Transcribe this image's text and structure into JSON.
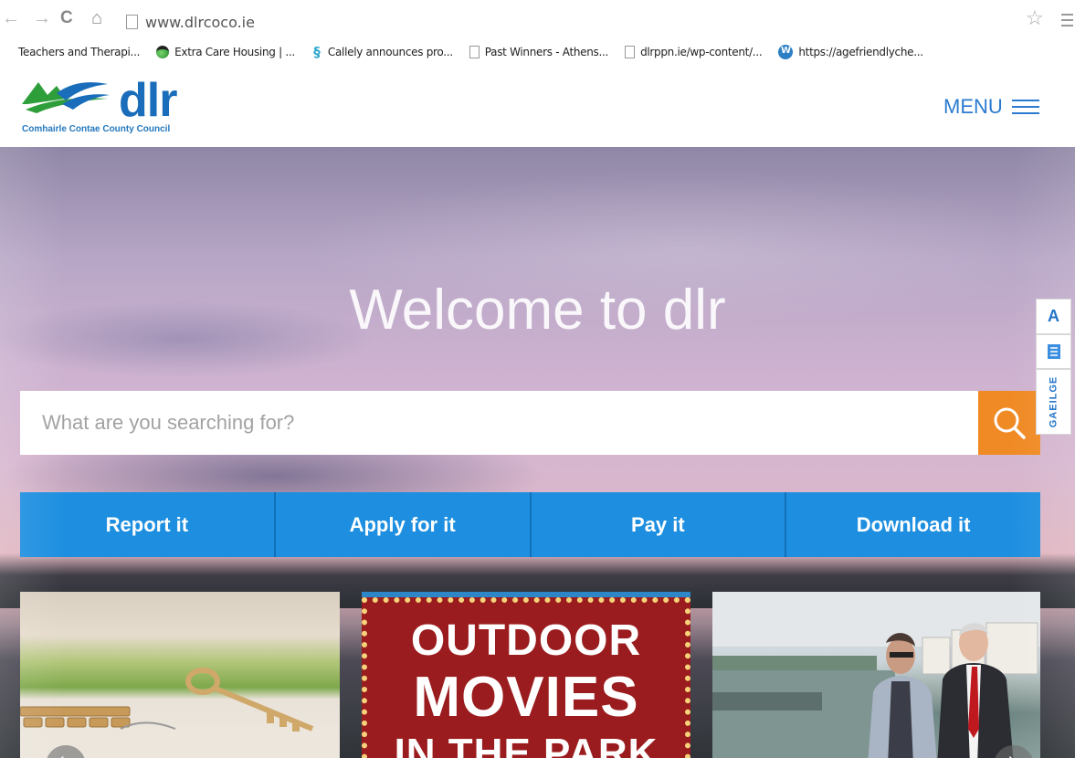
{
  "browser": {
    "url": "www.dlrcoco.ie",
    "bookmarks": [
      {
        "label": "Teachers and Therapi...",
        "icon": "none"
      },
      {
        "label": "Extra Care Housing | ...",
        "icon": "globe-icon"
      },
      {
        "label": "Callely announces pro...",
        "icon": "swirl-icon"
      },
      {
        "label": "Past Winners - Athens...",
        "icon": "page-icon"
      },
      {
        "label": "dlrppn.ie/wp-content/...",
        "icon": "page-icon"
      },
      {
        "label": "https://agefriendlyche...",
        "icon": "wordpress-icon"
      }
    ]
  },
  "header": {
    "logo_text": "dlr",
    "logo_subtitle": "Comhairle Contae County Council",
    "menu_label": "MENU"
  },
  "hero": {
    "title": "Welcome to dlr",
    "search_placeholder": "What are you searching for?"
  },
  "actions": [
    "Report it",
    "Apply for it",
    "Pay it",
    "Download it"
  ],
  "side_tabs": {
    "text_size": "A",
    "language": "GAEILGE"
  },
  "cards": {
    "movie": {
      "line1": "OUTDOOR",
      "line2": "MOVIES",
      "line3": "IN THE PARK"
    }
  },
  "colors": {
    "brand_blue": "#1a6dba",
    "action_blue": "#1e8fe0",
    "search_orange": "#f08a24",
    "logo_green": "#2e9e3a"
  }
}
